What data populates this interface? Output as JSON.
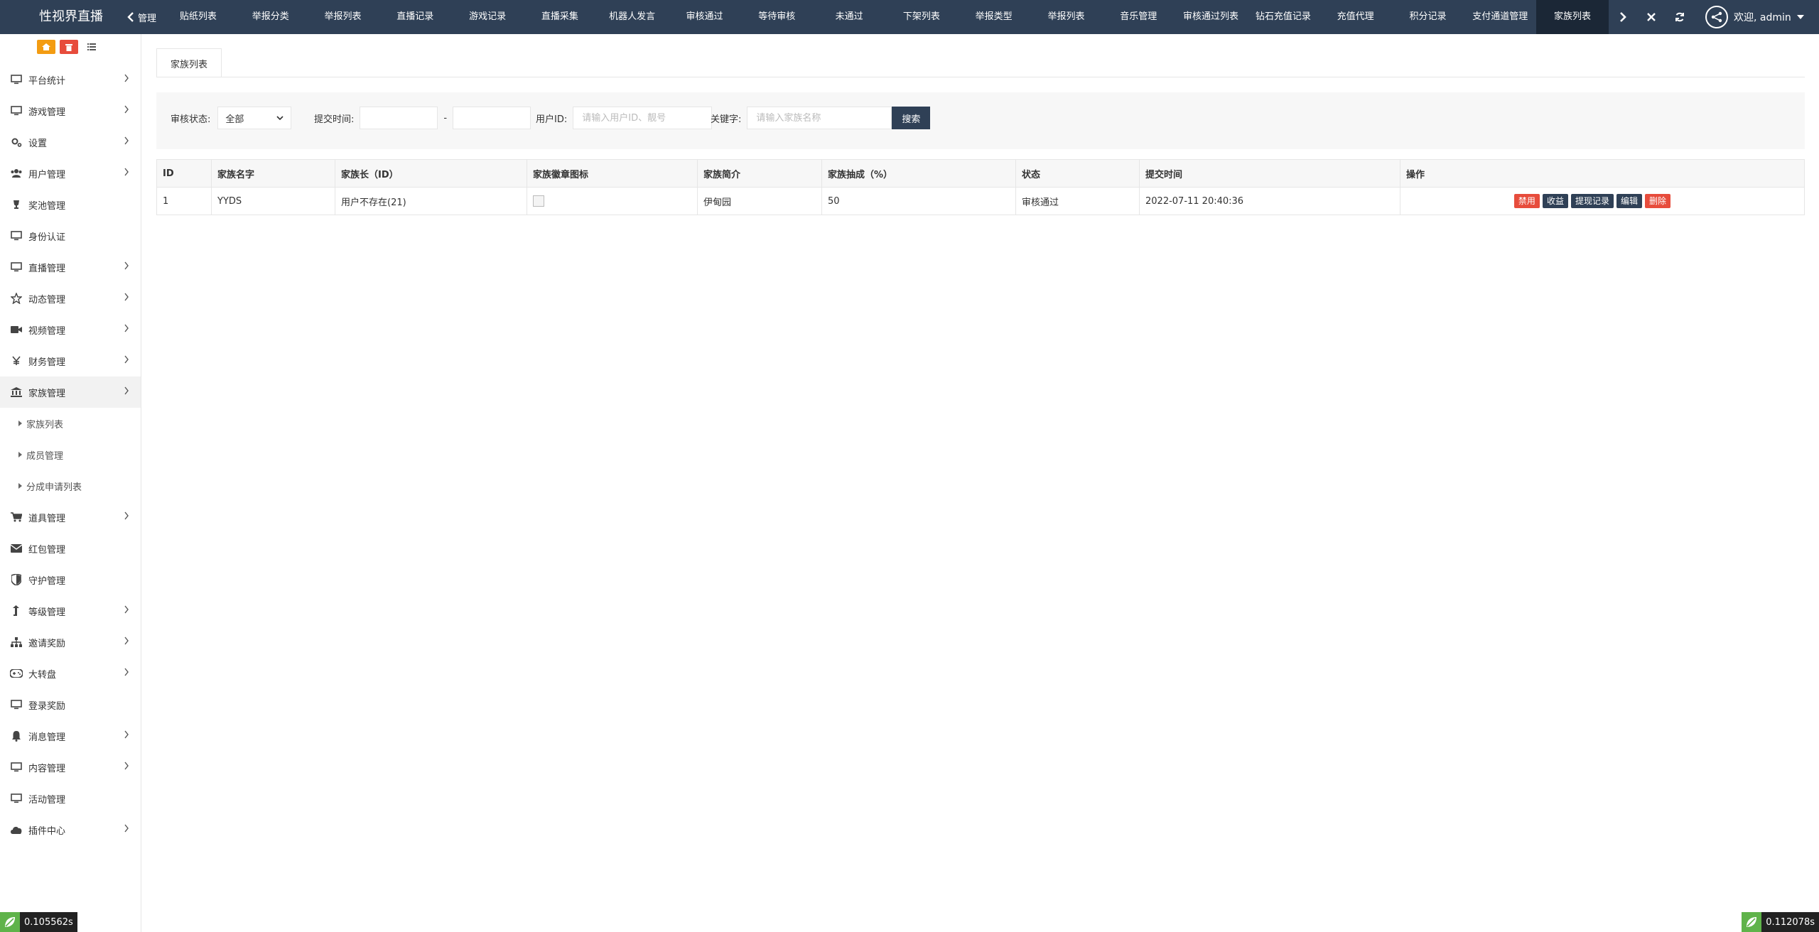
{
  "app": {
    "brand": "性视界直播",
    "nav_prev_label": "管理"
  },
  "top_tabs": [
    {
      "label": "贴纸列表"
    },
    {
      "label": "举报分类"
    },
    {
      "label": "举报列表"
    },
    {
      "label": "直播记录"
    },
    {
      "label": "游戏记录"
    },
    {
      "label": "直播采集"
    },
    {
      "label": "机器人发言"
    },
    {
      "label": "审核通过"
    },
    {
      "label": "等待审核"
    },
    {
      "label": "未通过"
    },
    {
      "label": "下架列表"
    },
    {
      "label": "举报类型"
    },
    {
      "label": "举报列表"
    },
    {
      "label": "音乐管理"
    },
    {
      "label": "审核通过列表"
    },
    {
      "label": "钻石充值记录"
    },
    {
      "label": "充值代理"
    },
    {
      "label": "积分记录"
    },
    {
      "label": "支付通道管理"
    },
    {
      "label": "家族列表",
      "active": true
    }
  ],
  "user": {
    "greeting": "欢迎, admin"
  },
  "sidebar": {
    "menu": [
      {
        "label": "平台统计",
        "icon": "monitor-icon",
        "chev": true
      },
      {
        "label": "游戏管理",
        "icon": "monitor-icon",
        "chev": true
      },
      {
        "label": "设置",
        "icon": "gears-icon",
        "chev": true
      },
      {
        "label": "用户管理",
        "icon": "users-icon",
        "chev": true
      },
      {
        "label": "奖池管理",
        "icon": "trophy-icon",
        "chev": false
      },
      {
        "label": "身份认证",
        "icon": "monitor-icon",
        "chev": false
      },
      {
        "label": "直播管理",
        "icon": "monitor-icon",
        "chev": true
      },
      {
        "label": "动态管理",
        "icon": "star-icon",
        "chev": true
      },
      {
        "label": "视频管理",
        "icon": "video-icon",
        "chev": true
      },
      {
        "label": "财务管理",
        "icon": "yen-icon",
        "chev": true
      },
      {
        "label": "家族管理",
        "icon": "bank-icon",
        "chev": true,
        "open": true
      }
    ],
    "submenu": [
      {
        "label": "家族列表"
      },
      {
        "label": "成员管理"
      },
      {
        "label": "分成申请列表"
      }
    ],
    "menu_after": [
      {
        "label": "道具管理",
        "icon": "cart-icon",
        "chev": true
      },
      {
        "label": "红包管理",
        "icon": "envelope-icon",
        "chev": false
      },
      {
        "label": "守护管理",
        "icon": "shield-icon",
        "chev": false
      },
      {
        "label": "等级管理",
        "icon": "level-up-icon",
        "chev": true
      },
      {
        "label": "邀请奖励",
        "icon": "sitemap-icon",
        "chev": true
      },
      {
        "label": "大转盘",
        "icon": "gamepad-icon",
        "chev": true
      },
      {
        "label": "登录奖励",
        "icon": "monitor-icon",
        "chev": false
      },
      {
        "label": "消息管理",
        "icon": "bell-icon",
        "chev": true
      },
      {
        "label": "内容管理",
        "icon": "monitor-icon",
        "chev": true
      },
      {
        "label": "活动管理",
        "icon": "monitor-icon",
        "chev": false
      },
      {
        "label": "插件中心",
        "icon": "cloud-icon",
        "chev": true
      }
    ]
  },
  "page": {
    "tab_title": "家族列表",
    "search": {
      "status_label": "审核状态:",
      "status_value": "全部",
      "time_label": "提交时间:",
      "time_sep": "-",
      "uid_label": "用户ID:",
      "uid_placeholder": "请输入用户ID、靓号",
      "keyword_label": "关键字:",
      "keyword_placeholder": "请输入家族名称",
      "search_button": "搜索"
    },
    "table": {
      "headers": [
        "ID",
        "家族名字",
        "家族长（ID）",
        "家族徽章图标",
        "家族简介",
        "家族抽成（%）",
        "状态",
        "提交时间",
        "操作"
      ],
      "rows": [
        {
          "id": "1",
          "name": "YYDS",
          "leader": "用户不存在(21)",
          "intro": "伊甸园",
          "rate": "50",
          "status": "审核通过",
          "time": "2022-07-11 20:40:36",
          "actions": [
            {
              "label": "禁用",
              "color": "#e74c3c"
            },
            {
              "label": "收益",
              "color": "#2f4056"
            },
            {
              "label": "提现记录",
              "color": "#2f4056"
            },
            {
              "label": "编辑",
              "color": "#2f4056"
            },
            {
              "label": "删除",
              "color": "#e74c3c"
            }
          ]
        }
      ]
    }
  },
  "timers": {
    "left": "0.105562s",
    "right": "0.112078s"
  },
  "colors": {
    "topbar": "#2f4056",
    "active_tab": "#1b2736",
    "danger": "#e74c3c",
    "orange": "#f39c12"
  }
}
